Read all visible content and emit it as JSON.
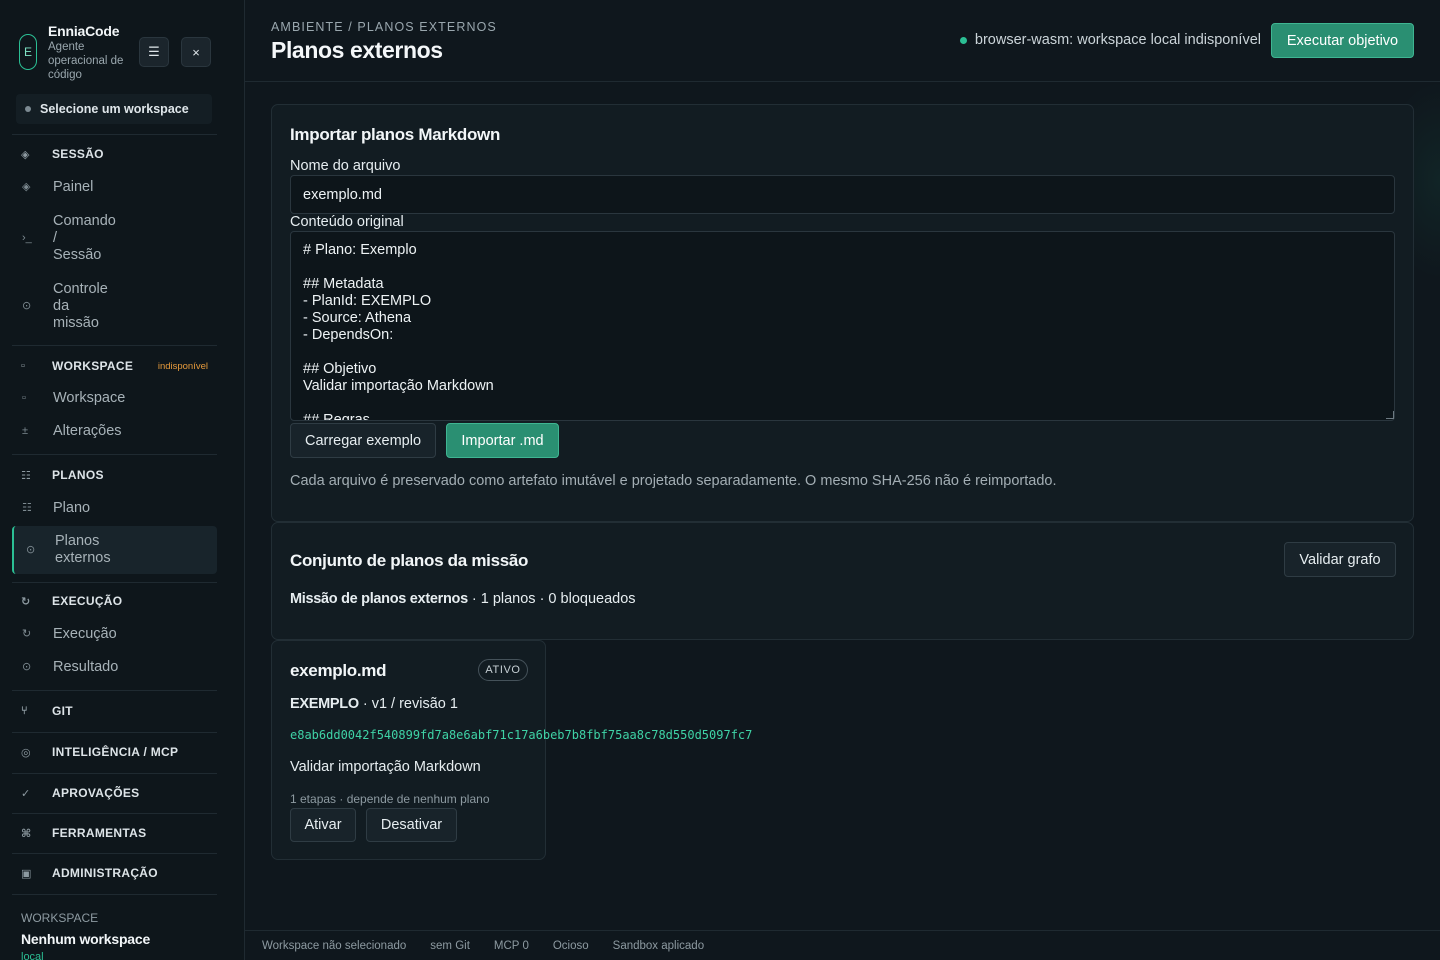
{
  "brand": {
    "logo_letter": "E",
    "name": "EnniaCode",
    "tagline": "Agente operacional de código"
  },
  "sidebar": {
    "menu_icon": "☰",
    "close_icon": "×",
    "workspace_select": "Selecione um workspace",
    "sections": {
      "sessao": "SESSÃO",
      "workspace": "WORKSPACE",
      "workspace_badge": "indisponível",
      "planos": "PLANOS",
      "execucao": "EXECUÇÃO",
      "git": "GIT",
      "inteligencia": "INTELIGÊNCIA / MCP",
      "aprovacoes": "APROVAÇÕES",
      "ferramentas": "FERRAMENTAS",
      "administracao": "ADMINISTRAÇÃO"
    },
    "items": {
      "painel": "Painel",
      "comando": "Comando\n/\nSessão",
      "controle": "Controle\nda\nmissão",
      "workspace": "Workspace",
      "alteracoes": "Alterações",
      "plano": "Plano",
      "planos_externos": "Planos\nexternos",
      "execucao": "Execução",
      "resultado": "Resultado"
    },
    "footer": {
      "label": "WORKSPACE",
      "value": "Nenhum workspace",
      "sub": "local"
    }
  },
  "header": {
    "breadcrumb": "AMBIENTE / PLANOS EXTERNOS",
    "title": "Planos externos",
    "status_text": "browser-wasm: workspace local indisponível",
    "run_button": "Executar objetivo"
  },
  "import_card": {
    "title": "Importar planos Markdown",
    "filename_label": "Nome do arquivo",
    "filename_value": "exemplo.md",
    "content_label": "Conteúdo original",
    "content_value": "# Plano: Exemplo\n\n## Metadata\n- PlanId: EXEMPLO\n- Source: Athena\n- DependsOn:\n\n## Objetivo\nValidar importação Markdown\n\n## Regras",
    "load_button": "Carregar exemplo",
    "import_button": "Importar .md",
    "help_text": "Cada arquivo é preservado como artefato imutável e projetado separadamente. O mesmo SHA-256 não é reimportado."
  },
  "mission_card": {
    "title": "Conjunto de planos da missão",
    "validate_button": "Validar grafo",
    "summary_name": "Missão de planos externos",
    "summary_rest": " · 1 planos · 0 bloqueados"
  },
  "plan_card": {
    "filename": "exemplo.md",
    "status_pill": "ATIVO",
    "plan_id": "EXEMPLO",
    "version": " · v1 / revisão 1",
    "hash": "e8ab6dd0042f540899fd7a8e6abf71c17a6beb7b8fbf75aa8c78d550d5097fc7",
    "goal": "Validar importação Markdown",
    "deps": "1 etapas · depende de nenhum plano",
    "activate_button": "Ativar",
    "deactivate_button": "Desativar"
  },
  "statusbar": {
    "workspace": "Workspace não selecionado",
    "git": "sem Git",
    "mcp": "MCP 0",
    "state": "Ocioso",
    "sandbox": "Sandbox aplicado"
  },
  "icons": {
    "sessao": "◈",
    "painel": "◈",
    "comando": "›_",
    "controle": "⊙",
    "workspace_sec": "▫",
    "workspace": "▫",
    "alteracoes": "±",
    "planos": "☷",
    "plano": "☷",
    "planos_externos": "⊙",
    "execucao_sec": "↻",
    "execucao": "↻",
    "resultado": "⊙",
    "git": "⑂",
    "inteligencia": "◎",
    "aprovacoes": "✓",
    "ferramentas": "⌘",
    "administracao": "▣"
  },
  "colors": {
    "accent": "#2bbf94",
    "warning": "#e59a3c",
    "hash": "#3fd3a6"
  }
}
